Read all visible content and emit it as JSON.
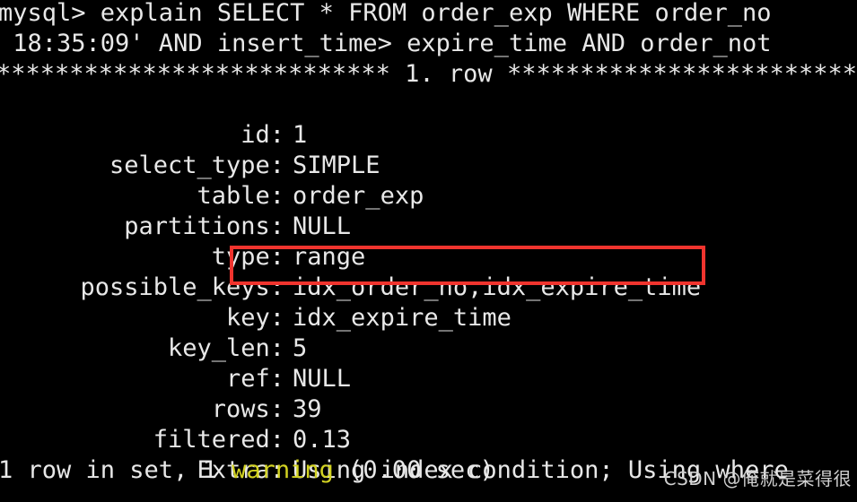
{
  "terminal": {
    "background_color": "#000000",
    "text_color": "#e8e8e8",
    "null_color": "#d63ad6",
    "warning_color": "#d2d222",
    "highlight_color": "#f0342e",
    "prompt_line": "mysql> explain SELECT * FROM order_exp WHERE order_no",
    "prompt_line_wrapped": " 18:35:09' AND insert_time> expire_time AND order_not",
    "row_banner": "*************************** 1. row ***************************",
    "footer": {
      "prefix": "1 row in set, 1 ",
      "warning": "warning",
      "suffix": " (0.00 sec)"
    }
  },
  "explain": {
    "fields": [
      {
        "label": "id:",
        "value": "1"
      },
      {
        "label": "select_type:",
        "value": "SIMPLE"
      },
      {
        "label": "table:",
        "value": "order_exp"
      },
      {
        "label": "partitions:",
        "value": "NULL"
      },
      {
        "label": "type:",
        "value": "range"
      },
      {
        "label": "possible_keys:",
        "value": "idx_order_no,idx_expire_time"
      },
      {
        "label": "key:",
        "value": "idx_expire_time"
      },
      {
        "label": "key_len:",
        "value": "5"
      },
      {
        "label": "ref:",
        "value": "NULL"
      },
      {
        "label": "rows:",
        "value": "39"
      },
      {
        "label": "filtered:",
        "value": "0.13"
      },
      {
        "label": "Extra:",
        "value": "Using index condition; Using where"
      }
    ]
  },
  "annotation": {
    "highlighted_value": "idx_order_no,idx_expire_time"
  },
  "watermark": {
    "text": "CSDN @俺就是菜得很"
  }
}
